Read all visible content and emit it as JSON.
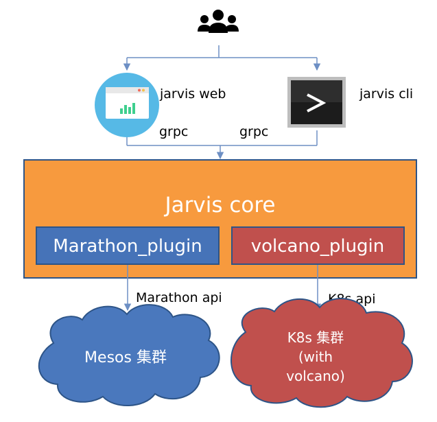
{
  "diagram": {
    "clients": {
      "web_label": "jarvis web",
      "cli_label": "jarvis cli",
      "web_edge_label": "grpc",
      "cli_edge_label": "grpc"
    },
    "core": {
      "title": "Jarvis core",
      "left_plugin": "Marathon_plugin",
      "right_plugin": "volcano_plugin"
    },
    "backends": {
      "left_edge_label": "Marathon api",
      "right_edge_label": "K8s api",
      "left_cloud": "Mesos 集群",
      "right_cloud_line1": "K8s 集群",
      "right_cloud_line2": "(with",
      "right_cloud_line3": "volcano)"
    },
    "colors": {
      "core": "#f79a3e",
      "core_border": "#2d5487",
      "left_plugin": "#4673b8",
      "right_plugin": "#c0504d",
      "left_cloud": "#4a78bd",
      "right_cloud": "#c0504d",
      "connector": "#6d8fc4",
      "web_icon_bg": "#56b9e6",
      "cli_icon": "#2e2e2e"
    },
    "icons": [
      "users-icon",
      "browser-chart-icon",
      "terminal-icon"
    ]
  }
}
